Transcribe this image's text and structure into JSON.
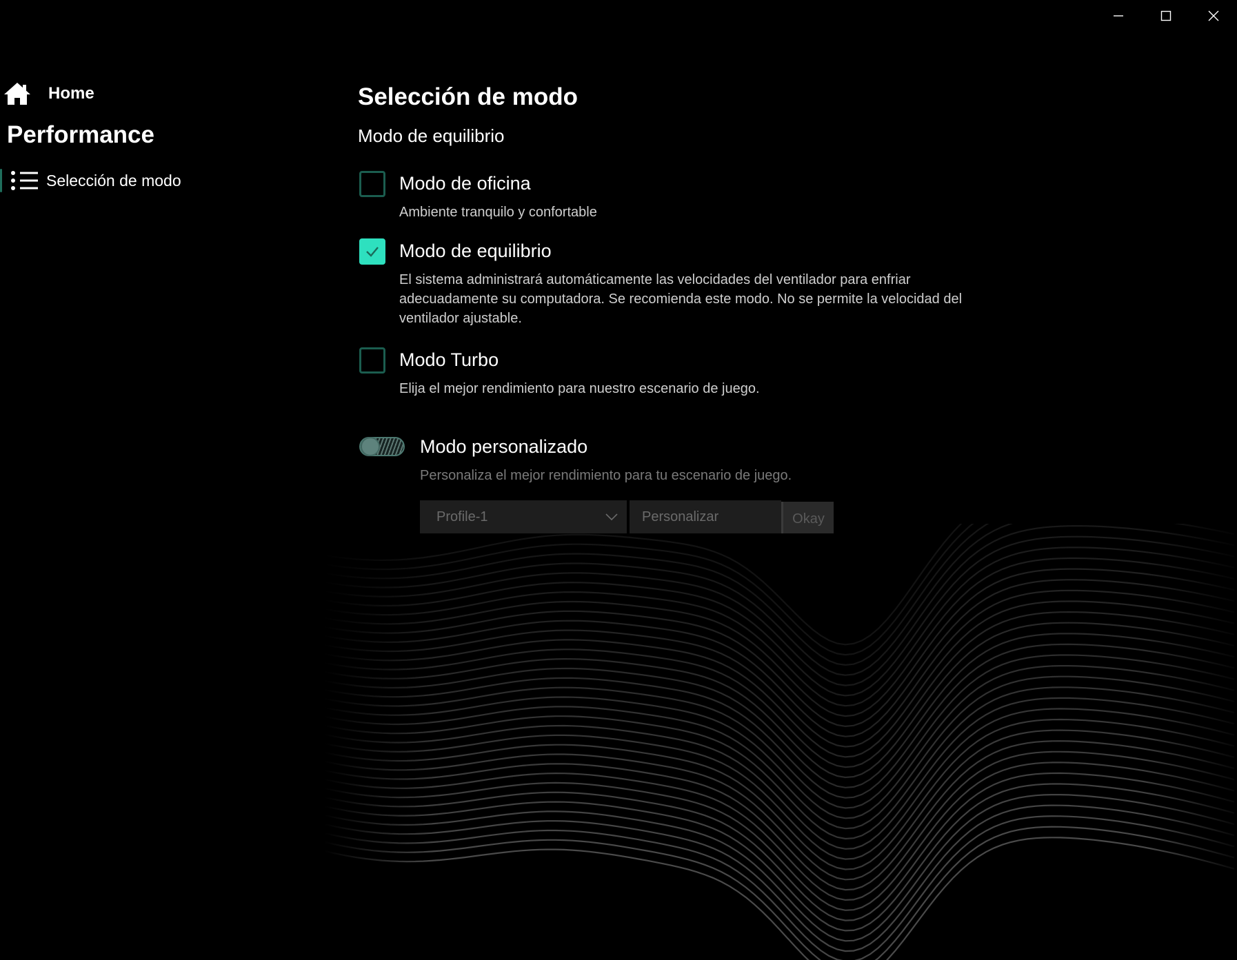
{
  "window": {
    "controls": {
      "minimize_icon": "minimize-icon",
      "maximize_icon": "maximize-icon",
      "close_icon": "close-icon"
    }
  },
  "sidebar": {
    "home_label": "Home",
    "section_title": "Performance",
    "items": [
      {
        "label": "Selección de modo",
        "icon": "list-icon",
        "active": true
      }
    ]
  },
  "main": {
    "title": "Selección de modo",
    "current_mode": "Modo de equilibrio",
    "options": [
      {
        "title": "Modo de oficina",
        "description": "Ambiente tranquilo y confortable",
        "checked": false
      },
      {
        "title": "Modo de equilibrio",
        "description": "El sistema administrará automáticamente las velocidades del ventilador para enfriar adecuadamente su computadora. Se recomienda este modo. No se permite la velocidad del ventilador ajustable.",
        "checked": true
      },
      {
        "title": "Modo Turbo",
        "description": "Elija el mejor rendimiento para nuestro escenario de juego.",
        "checked": false
      }
    ],
    "custom": {
      "title": "Modo personalizado",
      "description": "Personaliza el mejor rendimiento para tu escenario de juego.",
      "enabled": false,
      "profile_selected": "Profile-1",
      "input_placeholder": "Personalizar",
      "button_label": "Okay"
    }
  },
  "colors": {
    "accent": "#2ee0bf",
    "checkbox_border": "#1b5d4f",
    "background": "#000000"
  }
}
